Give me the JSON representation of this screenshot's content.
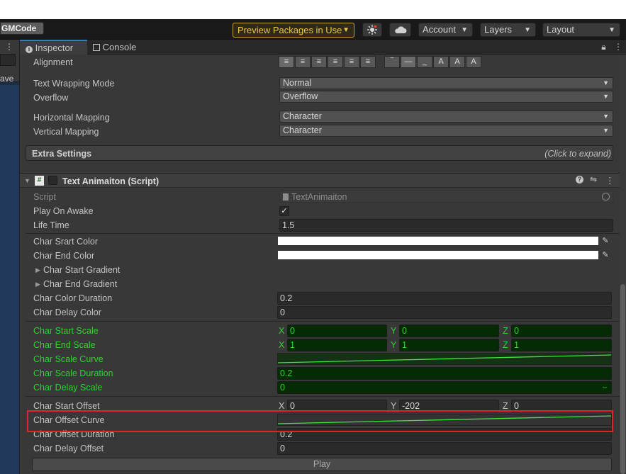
{
  "toolbar": {
    "project": "GMCode",
    "preview_packages": "Preview Packages in Use",
    "account": "Account",
    "layers": "Layers",
    "layout": "Layout",
    "dropdown_arrow": "▼"
  },
  "left_panel": {
    "dots": "⋮",
    "partial_text": "ave"
  },
  "tabs": [
    {
      "label": "Inspector",
      "icon": "info-icon"
    },
    {
      "label": "Console",
      "icon": "console-icon"
    }
  ],
  "text_settings": {
    "alignment_label": "Alignment",
    "text_wrapping_label": "Text Wrapping Mode",
    "text_wrapping_value": "Normal",
    "overflow_label": "Overflow",
    "overflow_value": "Overflow",
    "horizontal_mapping_label": "Horizontal Mapping",
    "horizontal_mapping_value": "Character",
    "vertical_mapping_label": "Vertical Mapping",
    "vertical_mapping_value": "Character",
    "extra_settings_label": "Extra Settings",
    "extra_settings_hint": "(Click to expand)"
  },
  "component": {
    "title": "Text Animaiton (Script)",
    "script_label": "Script",
    "script_value": "TextAnimaiton",
    "play_on_awake_label": "Play On Awake",
    "play_on_awake_checked": true,
    "check_mark": "✓",
    "life_time_label": "Life Time",
    "life_time_value": "1.5",
    "char_start_color_label": "Char Srart Color",
    "char_end_color_label": "Char End Color",
    "char_start_gradient_label": "Char Start Gradient",
    "char_end_gradient_label": "Char End Gradient",
    "char_color_duration_label": "Char Color Duration",
    "char_color_duration_value": "0.2",
    "char_delay_color_label": "Char Delay Color",
    "char_delay_color_value": "0",
    "char_start_scale_label": "Char Start Scale",
    "char_start_scale": {
      "x": "0",
      "y": "0",
      "z": "0"
    },
    "char_end_scale_label": "Char End Scale",
    "char_end_scale": {
      "x": "1",
      "y": "1",
      "z": "1"
    },
    "char_scale_curve_label": "Char Scale Curve",
    "char_scale_duration_label": "Char Scale Duration",
    "char_scale_duration_value": "0.2",
    "char_delay_scale_label": "Char Delay Scale",
    "char_delay_scale_value": "0",
    "char_start_offset_label": "Char Start Offset",
    "char_start_offset": {
      "x": "0",
      "y": "-202",
      "z": "0"
    },
    "char_offset_curve_label": "Char Offset Curve",
    "char_offset_duration_label": "Char Offset Duration",
    "char_offset_duration_value": "0.2",
    "char_delay_offset_label": "Char Delay Offset",
    "char_delay_offset_value": "0",
    "play_button": "Play",
    "axis_x": "X",
    "axis_y": "Y",
    "axis_z": "Z"
  },
  "colors": {
    "animated_green": "#31d131",
    "highlight_red": "#e0242a",
    "tab_accent": "#3a79bb"
  }
}
